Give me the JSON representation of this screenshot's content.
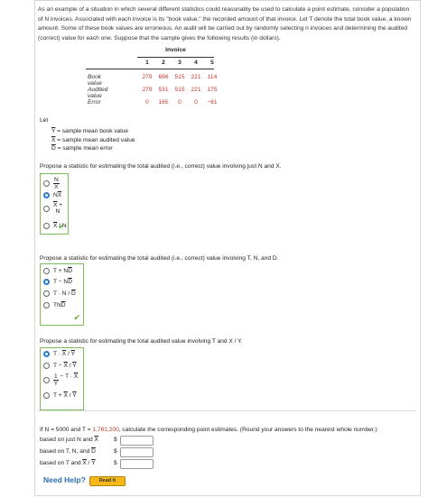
{
  "intro": "As an example of a situation in which several different statistics could reasonably be used to calculate a point estimate, consider a population of N invoices. Associated with each invoice is its \"book value,\" the recorded amount of that invoice. Let T denote the total book value, a known amount. Some of these book values are erroneous. An audit will be carried out by randomly selecting n invoices and determining the audited (correct) value for each one. Suppose that the sample gives the following results (in dollars).",
  "table": {
    "header": "Invoice",
    "columns": [
      "1",
      "2",
      "3",
      "4",
      "5"
    ],
    "rows": [
      {
        "label": "Book value",
        "values": [
          "279",
          "696",
          "515",
          "221",
          "114"
        ]
      },
      {
        "label": "Audited value",
        "values": [
          "279",
          "531",
          "515",
          "221",
          "175"
        ]
      },
      {
        "label": "Error",
        "values": [
          "0",
          "165",
          "0",
          "0",
          "−61"
        ]
      }
    ]
  },
  "let_label": "Let",
  "definitions": [
    {
      "sym": "Y",
      "text": " = sample mean book value"
    },
    {
      "sym": "X",
      "text": " = sample mean audited value"
    },
    {
      "sym": "D",
      "text": " = sample mean error"
    }
  ],
  "q1": {
    "prompt": "Propose a statistic for estimating the total audited (i.e., correct) value involving just N and X.",
    "options": [
      "N/X",
      "NX",
      "X + N",
      "X / N"
    ],
    "selected": 1
  },
  "q2": {
    "prompt": "Propose a statistic for estimating the total audited (i.e., correct) value involving T, N, and D.",
    "options": [
      "T + ND",
      "T − ND",
      "T · N / D",
      "TND"
    ],
    "selected": 1
  },
  "q3": {
    "prompt": "Propose a statistic for estimating the total audited value involving T and X / Y.",
    "options": [
      "T · X / Y",
      "T − X / Y",
      "1/Y − T · X",
      "T + X / Y"
    ],
    "selected": 0
  },
  "final": {
    "text_a": "If N = 5000 and T = ",
    "t_value": "1,761,200",
    "text_b": ", calculate the corresponding point estimates. (Round your answers to the nearest whole number.)",
    "answers": [
      {
        "label": "based on just N and X"
      },
      {
        "label": "based on T, N, and D"
      },
      {
        "label": "based on T and X / Y"
      }
    ],
    "currency": "$"
  },
  "help": {
    "need_help": "Need Help?",
    "read_it": "Read It"
  },
  "colors": {
    "selected": "#2a7ad2",
    "correct": "#7cbd5a",
    "red": "#c0392b"
  }
}
